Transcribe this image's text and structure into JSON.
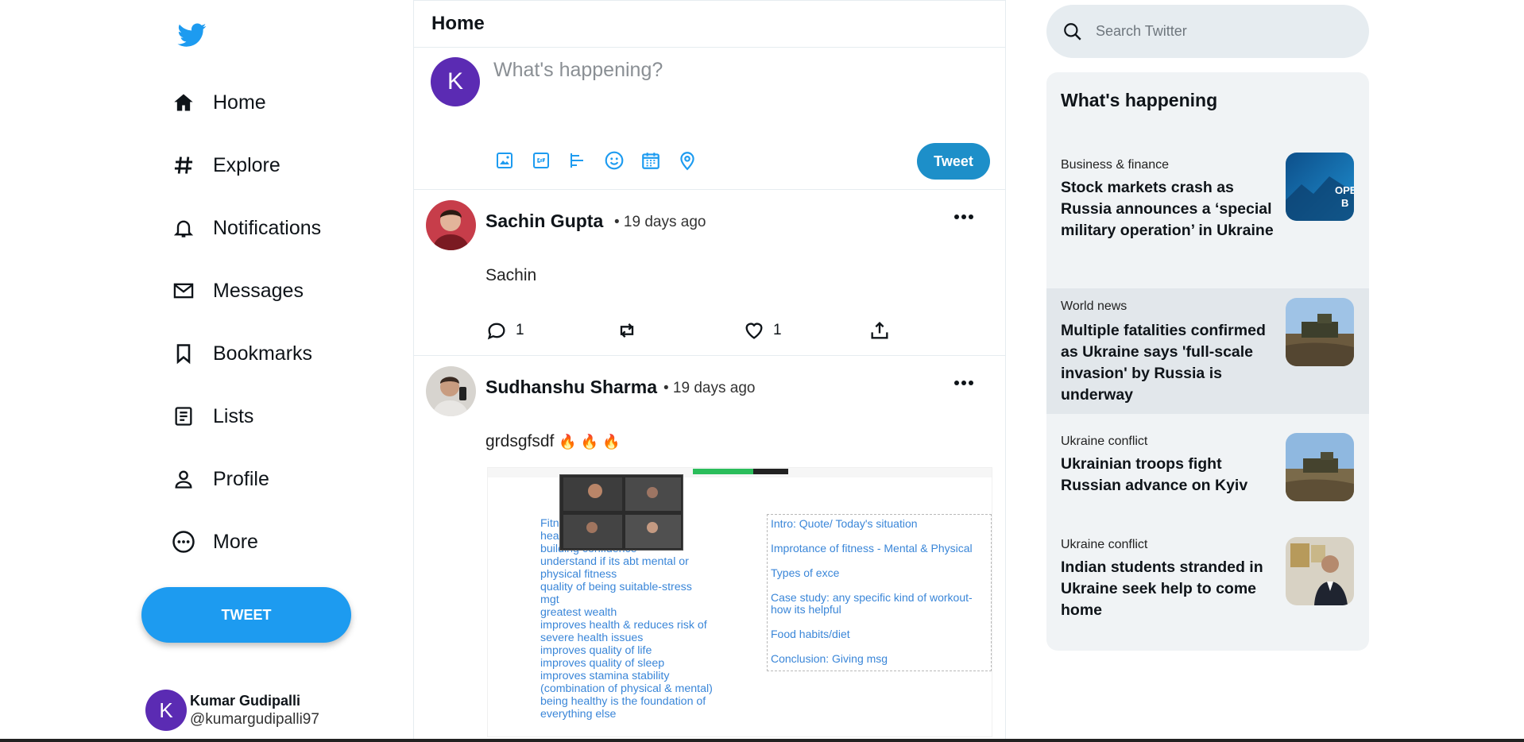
{
  "nav": {
    "items": [
      {
        "label": "Home"
      },
      {
        "label": "Explore"
      },
      {
        "label": "Notifications"
      },
      {
        "label": "Messages"
      },
      {
        "label": "Bookmarks"
      },
      {
        "label": "Lists"
      },
      {
        "label": "Profile"
      },
      {
        "label": "More"
      }
    ],
    "tweet_label": "TWEET"
  },
  "account": {
    "initial": "K",
    "name": "Kumar Gudipalli",
    "handle": "@kumargudipalli97"
  },
  "feed": {
    "title": "Home",
    "composer": {
      "initial": "K",
      "placeholder": "What's happening?",
      "tweet_label": "Tweet",
      "tools": [
        "image-icon",
        "gif-icon",
        "poll-icon",
        "emoji-icon",
        "schedule-icon",
        "location-icon"
      ]
    },
    "posts": [
      {
        "name": "Sachin Gupta",
        "time": "• 19 days ago",
        "text": "Sachin",
        "replies": "1",
        "likes": "1"
      },
      {
        "name": "Sudhanshu Sharma",
        "time": "• 19 days ago",
        "text": "grdsgfsdf",
        "emoji": "🔥 🔥 🔥",
        "image": {
          "left_notes": "Fitn                          te\nhea                          task\nbuilding confidence\nunderstand if its abt mental or\nphysical fitness\nquality of being suitable-stress\nmgt\ngreatest wealth\nimproves health & reduces risk of\nsevere health issues\nimproves quality of life\nimproves quality of sleep\nimproves stamina stability\n(combination of physical & mental)\nbeing healthy is the foundation of\neverything else",
          "right_notes": [
            "Intro: Quote/ Today's situation",
            "Improtance of fitness - Mental & Physical",
            "Types of exce",
            "Case study: any specific kind of workout- how its helpful",
            "Food habits/diet",
            "Conclusion: Giving msg"
          ]
        }
      }
    ]
  },
  "search": {
    "placeholder": "Search Twitter"
  },
  "trends": {
    "title": "What's happening",
    "items": [
      {
        "category": "Business & finance",
        "headline": "Stock markets crash as Russia announces a ‘special military operation’ in Ukraine"
      },
      {
        "category": "World news",
        "headline": "Multiple fatalities confirmed as Ukraine says 'full-scale invasion' by Russia is underway"
      },
      {
        "category": "Ukraine conflict",
        "headline": "Ukrainian troops fight Russian advance on Kyiv"
      },
      {
        "category": "Ukraine conflict",
        "headline": "Indian students stranded in Ukraine seek help to come home"
      }
    ]
  },
  "colors": {
    "brand": "#1d9bf0",
    "avatar": "#5b2bb3",
    "text": "#0f1419"
  }
}
